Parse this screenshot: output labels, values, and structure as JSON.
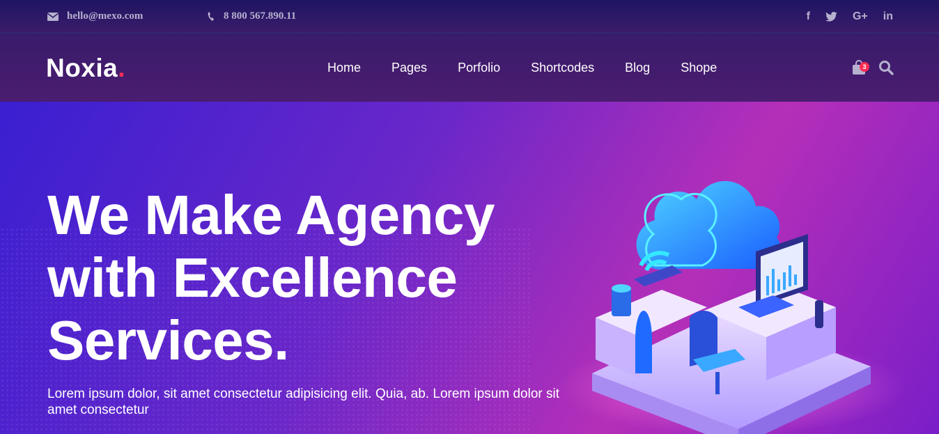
{
  "topbar": {
    "email": "hello@mexo.com",
    "phone": "8 800 567.890.11",
    "socials": [
      {
        "icon": "facebook-icon",
        "glyph": "f"
      },
      {
        "icon": "twitter-icon",
        "glyph": "🐦"
      },
      {
        "icon": "google-plus-icon",
        "glyph": "G+"
      },
      {
        "icon": "linkedin-icon",
        "glyph": "in"
      }
    ]
  },
  "header": {
    "logo_text": "Noxia",
    "logo_dot": ".",
    "nav": [
      "Home",
      "Pages",
      "Porfolio",
      "Shortcodes",
      "Blog",
      "Shope"
    ],
    "cart_count": "3"
  },
  "hero": {
    "title_line1": "We Make Agency",
    "title_line2": "with Excellence",
    "title_line3": "Services.",
    "subtitle": "Lorem ipsum dolor, sit amet consectetur adipisicing elit. Quia, ab. Lorem ipsum dolor sit amet consectetur"
  },
  "colors": {
    "accent": "#ff2d55",
    "topbar_bg": "#1e1563",
    "hero_start": "#3a1fd1",
    "hero_end": "#b52fb8"
  }
}
